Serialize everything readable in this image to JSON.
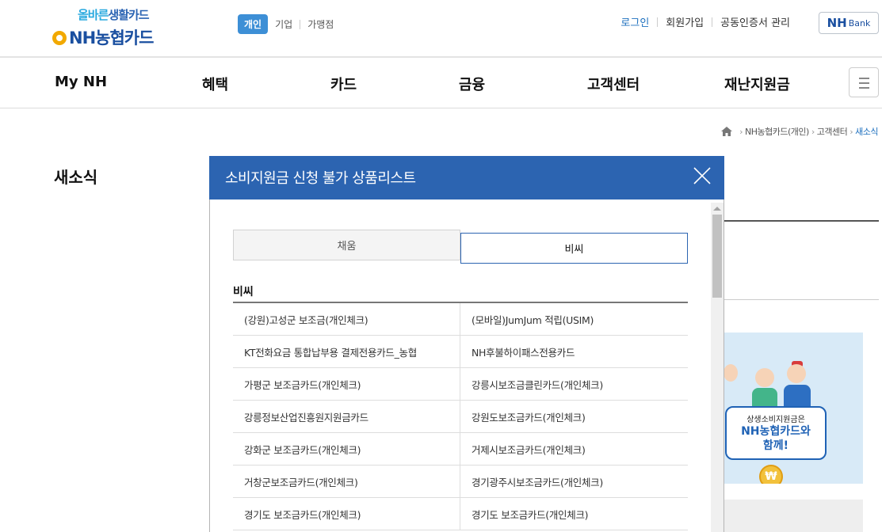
{
  "header": {
    "logo": {
      "slogan_a": "올바른",
      "slogan_b": "생활카드",
      "brand": "NH농협카드"
    },
    "segments": [
      "개인",
      "기업",
      "가맹점"
    ],
    "util": [
      "로그인",
      "회원가입",
      "공동인증서 관리"
    ],
    "nhbank": {
      "main": "NH",
      "sub": "Bank"
    }
  },
  "gnb": [
    "My NH",
    "혜택",
    "카드",
    "금융",
    "고객센터",
    "재난지원금"
  ],
  "breadcrumb": [
    "NH농협카드(개인)",
    "고객센터",
    "새소식"
  ],
  "page_title": "새소식",
  "banner": {
    "line1": "상생소비지원금은",
    "line2": "NH농협카드와",
    "line3": "함께!",
    "coin": "₩"
  },
  "modal": {
    "title": "소비지원금 신청 불가 상품리스트",
    "tabs": [
      "채움",
      "비씨"
    ],
    "active_tab": "비씨",
    "section_title": "비씨",
    "rows": [
      [
        "(강원)고성군 보조금(개인체크)",
        "(모바일)JumJum 적립(USIM)"
      ],
      [
        "KT전화요금 통합납부용 결제전용카드_농협",
        "NH후불하이패스전용카드"
      ],
      [
        "가평군 보조금카드(개인체크)",
        "강릉시보조금클린카드(개인체크)"
      ],
      [
        "강릉정보산업진흥원지원금카드",
        "강원도보조금카드(개인체크)"
      ],
      [
        "강화군 보조금카드(개인체크)",
        "거제시보조금카드(개인체크)"
      ],
      [
        "거창군보조금카드(개인체크)",
        "경기광주시보조금카드(개인체크)"
      ],
      [
        "경기도 보조금카드(개인체크)",
        "경기도 보조금카드(개인체크)"
      ]
    ]
  }
}
